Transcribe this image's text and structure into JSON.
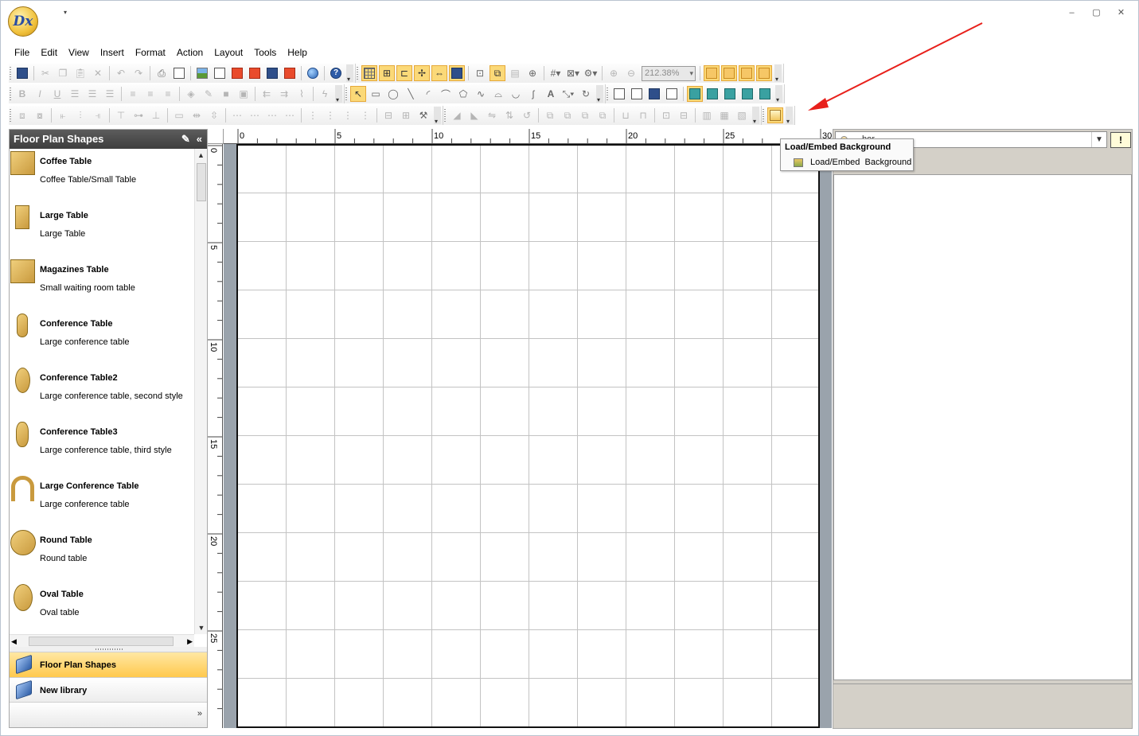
{
  "window": {
    "app_logo_text": "Dx",
    "controls": [
      "–",
      "▢",
      "✕"
    ]
  },
  "menu": [
    "File",
    "Edit",
    "View",
    "Insert",
    "Format",
    "Action",
    "Layout",
    "Tools",
    "Help"
  ],
  "toolbar": {
    "zoom_value": "212.38%"
  },
  "left_panel": {
    "title": "Floor Plan Shapes",
    "shapes": [
      {
        "name": "Coffee Table",
        "desc": "Coffee Table/Small Table",
        "thumb": "rect-wide"
      },
      {
        "name": "Large Table",
        "desc": "Large Table",
        "thumb": "rect-tall"
      },
      {
        "name": "Magazines Table",
        "desc": "Small waiting room table",
        "thumb": "rect-wide"
      },
      {
        "name": "Conference Table",
        "desc": "Large conference table",
        "thumb": "pill"
      },
      {
        "name": "Conference Table2",
        "desc": "Large conference table, second style",
        "thumb": "oval"
      },
      {
        "name": "Conference Table3",
        "desc": "Large conference table, third style",
        "thumb": "rounded"
      },
      {
        "name": "Large Conference Table",
        "desc": "Large conference table",
        "thumb": "arch"
      },
      {
        "name": "Round Table",
        "desc": "Round table",
        "thumb": "circle"
      },
      {
        "name": "Oval Table",
        "desc": "Oval table",
        "thumb": "oval"
      }
    ],
    "libraries": [
      {
        "label": "Floor Plan Shapes",
        "active": true
      },
      {
        "label": "New library",
        "active": false
      }
    ]
  },
  "rulers": {
    "horizontal": [
      "0",
      "5",
      "10",
      "15",
      "20",
      "25",
      "30"
    ],
    "vertical": [
      "0",
      "5",
      "10",
      "15",
      "20",
      "25"
    ]
  },
  "right_panel": {
    "combo_value": "hor"
  },
  "tooltip": {
    "title": "Load/Embed Background",
    "description": "Load/Embed  Background"
  },
  "colors": {
    "accent_highlight": "#fbd978",
    "annotation_arrow": "#e8201b",
    "canvas_bg": "#9aa3ac"
  }
}
